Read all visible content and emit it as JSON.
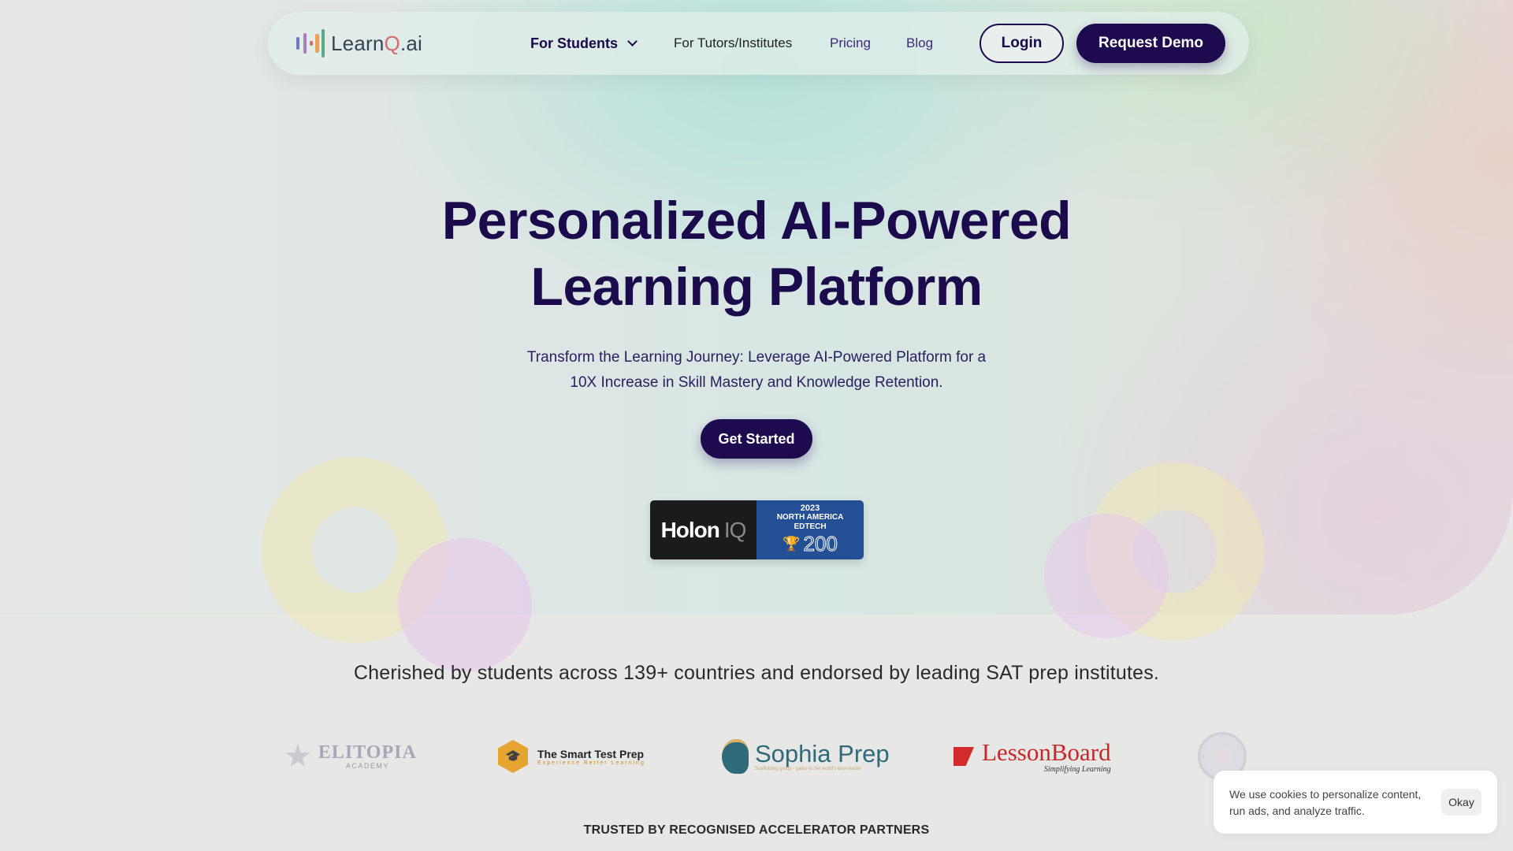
{
  "brand": {
    "name_prefix": "Learn",
    "name_q": "Q",
    "name_suffix": ".ai"
  },
  "nav": {
    "items": [
      {
        "label": "For Students",
        "has_dropdown": true
      },
      {
        "label": "For Tutors/Institutes"
      },
      {
        "label": "Pricing"
      },
      {
        "label": "Blog"
      }
    ],
    "login_label": "Login",
    "demo_label": "Request Demo"
  },
  "hero": {
    "title_line1": "Personalized AI-Powered",
    "title_line2": "Learning Platform",
    "subtitle_line1": "Transform the Learning Journey: Leverage AI-Powered Platform for a",
    "subtitle_line2": "10X Increase in Skill Mastery and Knowledge Retention.",
    "cta_label": "Get Started"
  },
  "badge": {
    "left_text": "Holon",
    "left_iq": "IQ",
    "year": "2023",
    "region": "NORTH AMERICA",
    "category": "EDTECH",
    "rank": "200"
  },
  "social_proof": {
    "headline": "Cherished by students across 139+ countries and endorsed by leading SAT prep institutes."
  },
  "partners": [
    {
      "name": "ELITOPIA",
      "sub": "ACADEMY"
    },
    {
      "name": "The Smart Test Prep",
      "sub": "Experience Better Learning"
    },
    {
      "name": "Sophia Prep",
      "sub": "Scaffolding group - gates to the world's best leader"
    },
    {
      "name": "LessonBoard",
      "sub": "Simplifying Learning"
    }
  ],
  "accelerators": {
    "heading": "TRUSTED BY RECOGNISED ACCELERATOR PARTNERS"
  },
  "cookie": {
    "message": "We use cookies to personalize content, run ads, and analyze traffic.",
    "button_label": "Okay"
  },
  "colors": {
    "primary": "#1e0a4e",
    "logo_accent": "#d46a6a",
    "badge_blue": "#234f94"
  }
}
